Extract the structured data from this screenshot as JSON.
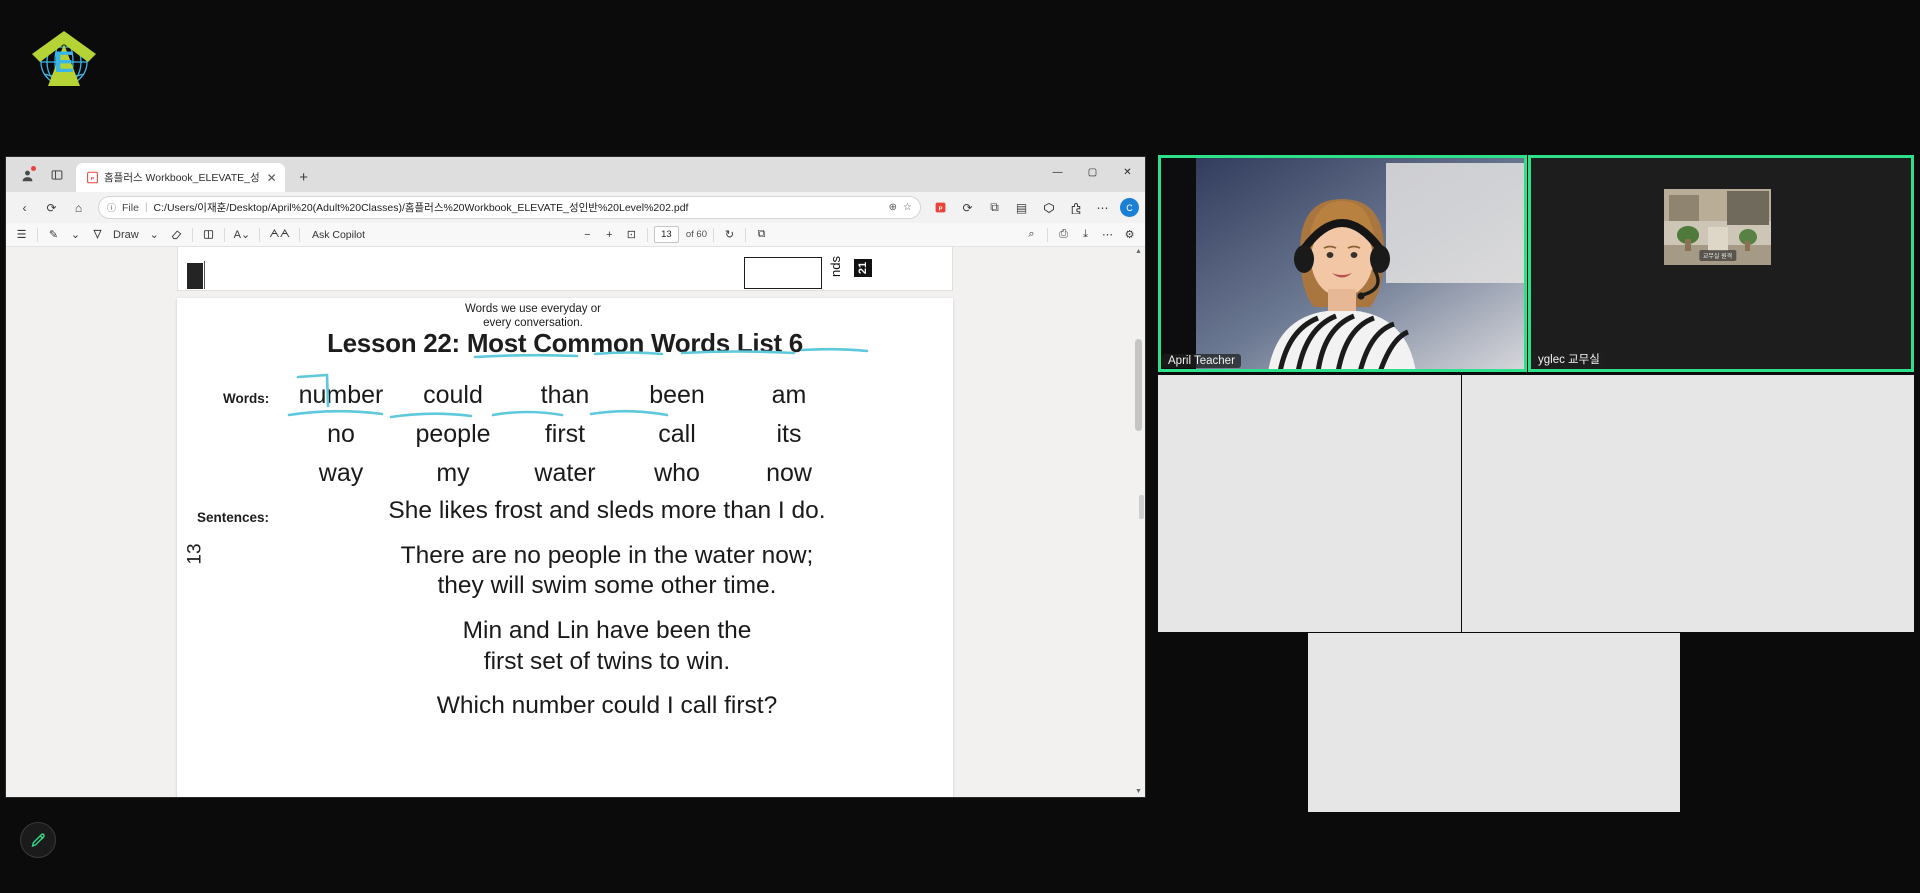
{
  "logo": {
    "letter": "E",
    "arrow_color": "#b5d334",
    "globe_color": "#3bb5e8",
    "name": "elevate-logo"
  },
  "browser": {
    "tab": {
      "title": "홈플러스 Workbook_ELEVATE_성",
      "favicon": "pdf-icon",
      "close": "✕"
    },
    "newtab_label": "+",
    "window_controls": {
      "minimize": "—",
      "maximize": "▢",
      "close": "✕"
    },
    "nav": {
      "back": "‹",
      "forward": "›",
      "refresh": "⟳",
      "home": "⌂"
    },
    "omnibox": {
      "lock_icon": "ⓘ",
      "scheme": "File",
      "separator": "|",
      "url": "C:/Users/이재훈/Desktop/April%20(Adult%20Classes)/홈플러스%20Workbook_ELEVATE_성인반%20Level%202.pdf",
      "zoom_icon": "⊕",
      "favorite_icon": "☆"
    },
    "toolbar_icons": {
      "collections": "▤",
      "split": "⧉",
      "extensions": "⚙",
      "copilot_brand": "C",
      "more": "⋯"
    }
  },
  "pdf_toolbar": {
    "toc": "☰",
    "highlight": "✎",
    "highlight_caret": "⌄",
    "draw": "Draw",
    "draw_caret": "⌄",
    "erase": "⌫",
    "pageview": "▯",
    "read_aloud": "A⌄",
    "text_select": "ᗅᗅ",
    "ask_copilot": "Ask Copilot",
    "zoom_out": "−",
    "zoom_in": "+",
    "fit": "⊡",
    "page_current": "13",
    "page_total": "of 60",
    "rotate": "↻",
    "layout": "⧉",
    "search": "⌕",
    "print": "⎙",
    "save": "⤓",
    "more": "⋯",
    "settings": "⚙"
  },
  "pdf_page": {
    "ink_note": "Words we use everyday or\never y conversation.",
    "ink_note_line1": "Words we use everyday or",
    "ink_note_line2": "every conversation.",
    "title": "Lesson 22: Most Common Words List 6",
    "words_label": "Words:",
    "sentences_label": "Sentences:",
    "page_number": "13",
    "word_rows": [
      [
        "number",
        "could",
        "than",
        "been",
        "am"
      ],
      [
        "no",
        "people",
        "first",
        "call",
        "its"
      ],
      [
        "way",
        "my",
        "water",
        "who",
        "now"
      ]
    ],
    "sentences": [
      "She likes frost and sleds more than I do.",
      "There are no people in the water now;\nthey will swim some other time.",
      "Min and Lin have been the\nfirst set of twins to win.",
      "Which number could I call first?"
    ],
    "sentence_lines": [
      [
        "She likes frost and sleds more than I do."
      ],
      [
        "There are no people in the water now;",
        "they will swim some other time."
      ],
      [
        "Min and Lin have been the",
        "first set of twins to win."
      ],
      [
        "Which number could I call first?"
      ]
    ],
    "ink_color": "#5ec8dc",
    "preview_strip": {
      "page_badge": "21",
      "side_text": "nds"
    }
  },
  "video_conference": {
    "participants": [
      {
        "name": "April Teacher",
        "active_speaker": true
      },
      {
        "name": "yglec 교무실",
        "active_speaker": true,
        "pip_label": "교무실 원격"
      }
    ]
  },
  "floating_button": {
    "icon": "pencil-icon",
    "color": "#2fe08b"
  }
}
